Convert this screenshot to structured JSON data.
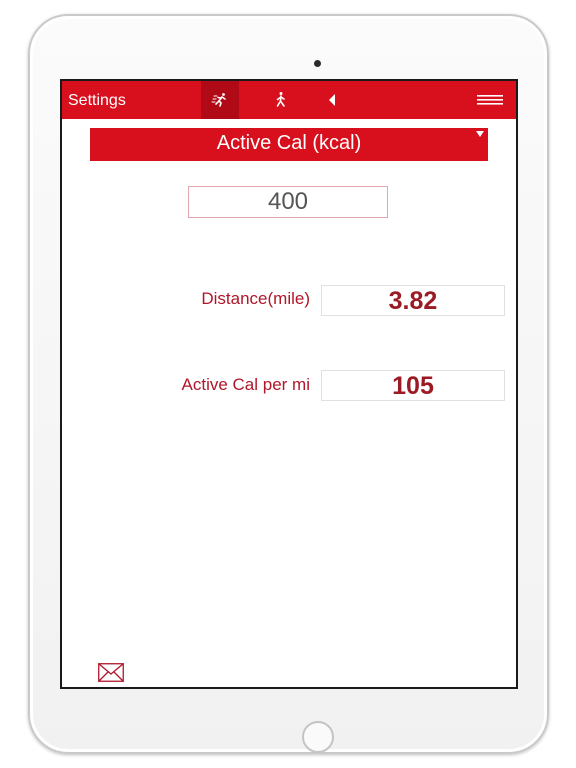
{
  "navbar": {
    "title": "Settings",
    "icons": [
      "running-icon",
      "walking-icon",
      "back-arrow-icon",
      "hamburger-menu-icon"
    ]
  },
  "selector": {
    "label": "Active Cal (kcal)"
  },
  "input": {
    "value": "400"
  },
  "results": {
    "distance_label": "Distance(mile)",
    "distance_value": "3.82",
    "cal_per_mi_label": "Active Cal per mi",
    "cal_per_mi_value": "105"
  },
  "colors": {
    "brand_red": "#d8101e",
    "value_text": "#9b1b24",
    "label_text": "#b0162a"
  }
}
